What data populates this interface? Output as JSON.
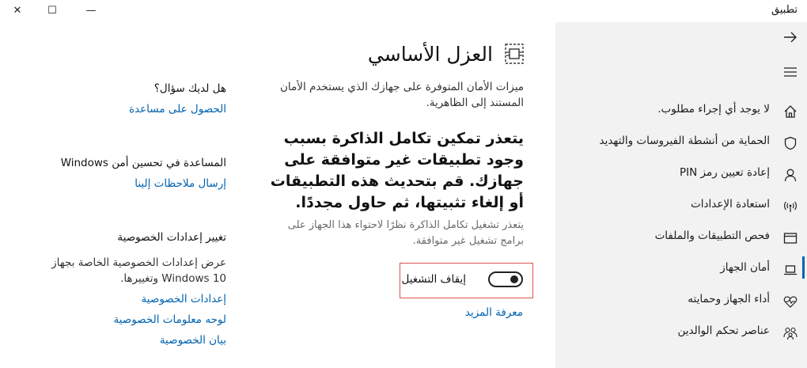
{
  "window": {
    "title": "تطبيق",
    "close_glyph": "✕",
    "maximize_glyph": "☐",
    "minimize_glyph": "—"
  },
  "sidebar": {
    "back_icon": "arrow-icon",
    "menu_icon": "hamburger-icon",
    "items": [
      {
        "label": "لا يوجد أي إجراء مطلوب.",
        "icon": "home-icon",
        "active": false
      },
      {
        "label": "الحماية من أنشطة الفيروسات والتهديد",
        "icon": "shield-icon",
        "active": false
      },
      {
        "label": "إعادة تعيين رمز PIN",
        "icon": "person-icon",
        "active": false
      },
      {
        "label": "استعادة الإعدادات",
        "icon": "wireless-icon",
        "active": false
      },
      {
        "label": "فحص التطبيقات والملفات",
        "icon": "browser-window-icon",
        "active": false
      },
      {
        "label": "أمان الجهاز",
        "icon": "laptop-icon",
        "active": true
      },
      {
        "label": "أداء الجهاز وحمايته",
        "icon": "heart-pulse-icon",
        "active": false
      },
      {
        "label": "عناصر تحكم الوالدين",
        "icon": "family-icon",
        "active": false
      }
    ]
  },
  "main": {
    "title": "العزل الأساسي",
    "title_icon": "core-isolation-icon",
    "intro": "ميزات الأمان المتوفرة على جهازك الذي يستخدم الأمان المستند إلى الظاهرية.",
    "warning_heading": "يتعذر تمكين تكامل الذاكرة بسبب وجود تطبيقات غير متوافقة على جهازك. قم بتحديث هذه التطبيقات أو إلغاء تثبيتها، ثم حاول مجددًا.",
    "warning_desc": "يتعذر تشغيل تكامل الذاكرة نظرًا لاحتواء هذا الجهاز على برامج تشغيل غير متوافقة.",
    "toggle_label": "إيقاف التشغيل",
    "toggle_on": false,
    "learn_more": "معرفة المزيد"
  },
  "aside": {
    "question_heading": "هل لديك سؤال؟",
    "get_help_link": "الحصول على مساعدة",
    "improve_heading": "المساعدة في تحسين أمن Windows",
    "feedback_link": "إرسال ملاحظات إلينا",
    "privacy_heading": "تغيير إعدادات الخصوصية",
    "privacy_text": "عرض إعدادات الخصوصية الخاصة بجهاز Windows 10 وتغييرها.",
    "privacy_links": [
      "إعدادات الخصوصية",
      "لوحه معلومات الخصوصية",
      "بيان الخصوصية"
    ]
  },
  "colors": {
    "accent": "#0063b1",
    "sidebar_bg": "#f2f2f2",
    "highlight_border": "#d9534f"
  }
}
